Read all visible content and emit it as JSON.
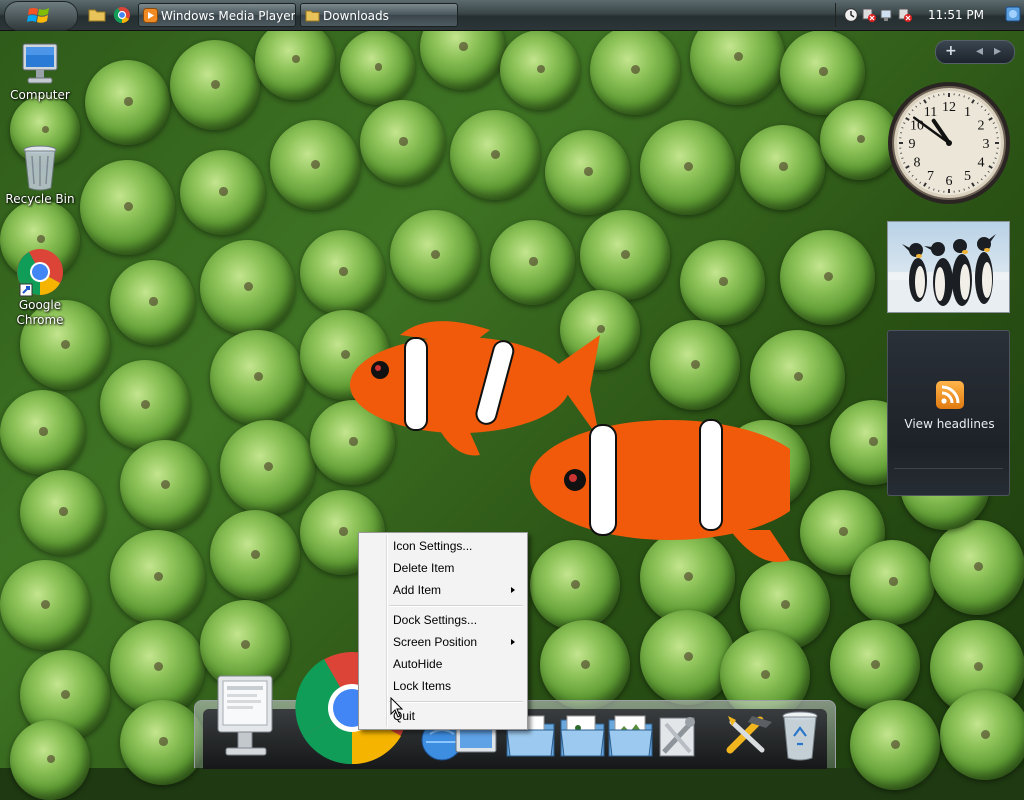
{
  "taskbar": {
    "start_label": "Start",
    "quick_launch": [
      "folder-icon",
      "chrome-icon"
    ],
    "tasks": [
      {
        "label": "Windows Media Player",
        "icon": "media-player-icon"
      },
      {
        "label": "Downloads",
        "icon": "folder-icon"
      }
    ],
    "tray_icons": [
      "volume-icon",
      "network-error-icon",
      "network-icon",
      "security-alert-icon"
    ],
    "time": "11:51 PM"
  },
  "desktop": {
    "icons": [
      {
        "label": "Computer",
        "icon": "computer-icon"
      },
      {
        "label": "Recycle Bin",
        "icon": "recycle-bin-icon"
      },
      {
        "label": "Google Chrome",
        "icon": "chrome-icon"
      }
    ]
  },
  "sidebar": {
    "controls": [
      "+",
      "◂",
      "▸"
    ],
    "clock": {
      "hour": 10,
      "minute": 51,
      "numbers": [
        "12",
        "1",
        "2",
        "3",
        "4",
        "5",
        "6",
        "7",
        "8",
        "9",
        "10",
        "11"
      ]
    },
    "feed": {
      "label": "View headlines"
    }
  },
  "context_menu": {
    "items": [
      {
        "label": "Icon Settings...",
        "submenu": false
      },
      {
        "label": "Delete Item",
        "submenu": false
      },
      {
        "label": "Add Item",
        "submenu": true
      },
      {
        "label": "Dock Settings...",
        "submenu": false
      },
      {
        "label": "Screen Position",
        "submenu": true
      },
      {
        "label": "AutoHide",
        "submenu": false
      },
      {
        "label": "Lock Items",
        "submenu": false
      },
      {
        "label": "Quit",
        "submenu": false
      }
    ]
  },
  "dock": {
    "items": [
      "computer-icon",
      "chrome-icon",
      "internet-icon",
      "documents-folder-icon",
      "music-folder-icon",
      "pictures-folder-icon",
      "tools-icon",
      "tools-icon",
      "recycle-bin-icon"
    ]
  },
  "colors": {
    "taskbar": "#2c3638",
    "menu_bg": "#f3f3f3",
    "wallpaper_green": "#5f9c34",
    "fish_orange": "#f05a0a"
  }
}
